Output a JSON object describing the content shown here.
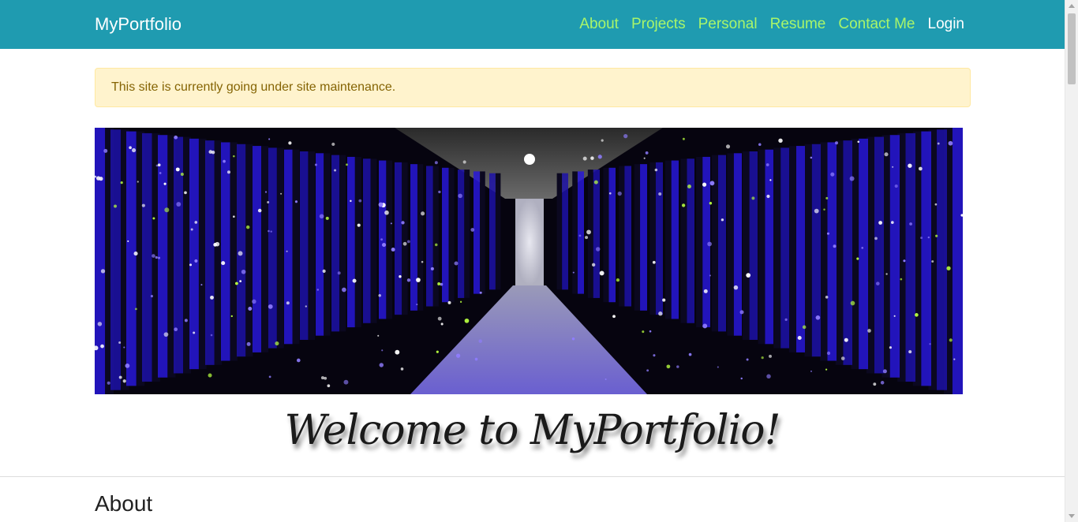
{
  "navbar": {
    "brand": "MyPortfolio",
    "links": [
      "About",
      "Projects",
      "Personal",
      "Resume",
      "Contact Me"
    ],
    "login": "Login"
  },
  "alert": {
    "message": "This site is currently going under site maintenance."
  },
  "hero": {
    "title": "Welcome to MyPortfolio!"
  },
  "about": {
    "heading": "About"
  },
  "colors": {
    "navbar_bg": "#1f9bb0",
    "nav_link": "#a8f56a",
    "alert_bg": "#fff3cd",
    "alert_text": "#856404"
  }
}
